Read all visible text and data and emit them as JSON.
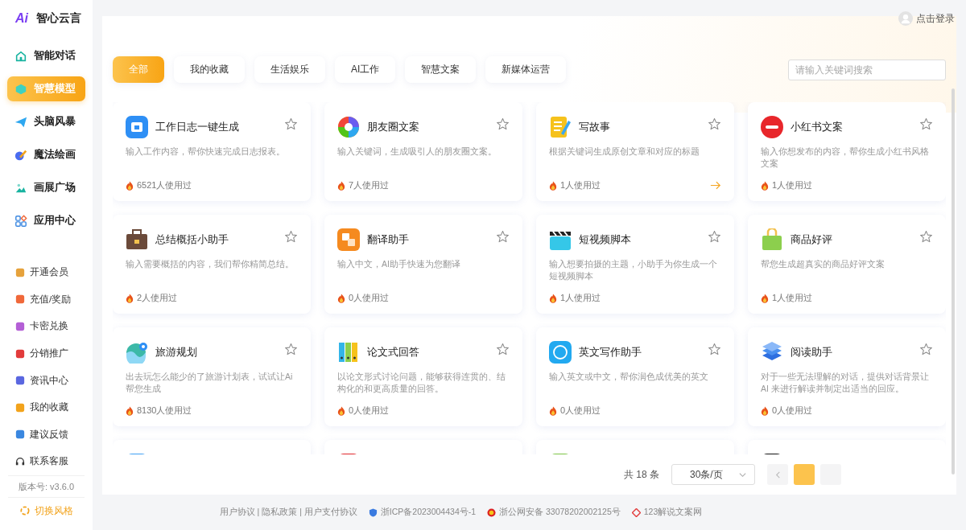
{
  "logo": {
    "mark": "Ai",
    "name": "智心云言"
  },
  "nav": [
    {
      "label": "智能对话",
      "selected": false
    },
    {
      "label": "智慧模型",
      "selected": true
    },
    {
      "label": "头脑风暴",
      "selected": false
    },
    {
      "label": "魔法绘画",
      "selected": false
    },
    {
      "label": "画展广场",
      "selected": false
    },
    {
      "label": "应用中心",
      "selected": false
    }
  ],
  "menu": [
    {
      "label": "开通会员"
    },
    {
      "label": "充值/奖励"
    },
    {
      "label": "卡密兑换"
    },
    {
      "label": "分销推广"
    },
    {
      "label": "资讯中心"
    },
    {
      "label": "我的收藏"
    },
    {
      "label": "建议反馈"
    },
    {
      "label": "联系客服"
    }
  ],
  "version": "版本号: v3.6.0",
  "switch_style": "切换风格",
  "login": "点击登录",
  "tabs": [
    {
      "label": "全部",
      "selected": true
    },
    {
      "label": "我的收藏",
      "selected": false
    },
    {
      "label": "生活娱乐",
      "selected": false
    },
    {
      "label": "AI工作",
      "selected": false
    },
    {
      "label": "智慧文案",
      "selected": false
    },
    {
      "label": "新媒体运营",
      "selected": false
    }
  ],
  "search": {
    "placeholder": "请输入关键词搜索"
  },
  "cards": [
    {
      "title": "工作日志一键生成",
      "desc": "输入工作内容，帮你快速完成日志报表。",
      "usage": "6521人使用过",
      "hovered": false
    },
    {
      "title": "朋友圈文案",
      "desc": "输入关键词，生成吸引人的朋友圈文案。",
      "usage": "7人使用过",
      "hovered": false
    },
    {
      "title": "写故事",
      "desc": "根据关键词生成原创文章和对应的标题",
      "usage": "1人使用过",
      "hovered": true
    },
    {
      "title": "小红书文案",
      "desc": "输入你想发布的内容，帮你生成小红书风格文案",
      "usage": "1人使用过",
      "hovered": false
    },
    {
      "title": "总结概括小助手",
      "desc": "输入需要概括的内容，我们帮你精简总结。",
      "usage": "2人使用过",
      "hovered": false
    },
    {
      "title": "翻译助手",
      "desc": "输入中文，AI助手快速为您翻译",
      "usage": "0人使用过",
      "hovered": false
    },
    {
      "title": "短视频脚本",
      "desc": "输入想要拍摄的主题，小助手为你生成一个短视频脚本",
      "usage": "1人使用过",
      "hovered": false
    },
    {
      "title": "商品好评",
      "desc": "帮您生成超真实的商品好评文案",
      "usage": "1人使用过",
      "hovered": false
    },
    {
      "title": "旅游规划",
      "desc": "出去玩怎么能少的了旅游计划表，试试让Ai帮您生成",
      "usage": "8130人使用过",
      "hovered": false
    },
    {
      "title": "论文式回答",
      "desc": "以论文形式讨论问题，能够获得连贯的、结构化的和更高质量的回答。",
      "usage": "0人使用过",
      "hovered": false
    },
    {
      "title": "英文写作助手",
      "desc": "输入英文或中文，帮你润色成优美的英文",
      "usage": "0人使用过",
      "hovered": false
    },
    {
      "title": "阅读助手",
      "desc": "对于一些无法理解的对话，提供对话背景让 AI 来进行解读并制定出适当的回应。",
      "usage": "0人使用过",
      "hovered": false
    }
  ],
  "partial_cards": [
    {
      "color": "#3d9ff3"
    },
    {
      "color": "#e0262b"
    },
    {
      "color": "#7cc444"
    },
    {
      "color": "#111111"
    }
  ],
  "pagination": {
    "total": "共 18 条",
    "page_size": "30条/页",
    "pages": [
      {
        "selected": true
      },
      {
        "selected": false
      }
    ]
  },
  "footer": {
    "links": "用户协议 | 隐私政策 | 用户支付协议",
    "icp": "浙ICP备2023004434号-1",
    "police": "浙公网安备 33078202002125号",
    "site": "123解说文案网"
  }
}
